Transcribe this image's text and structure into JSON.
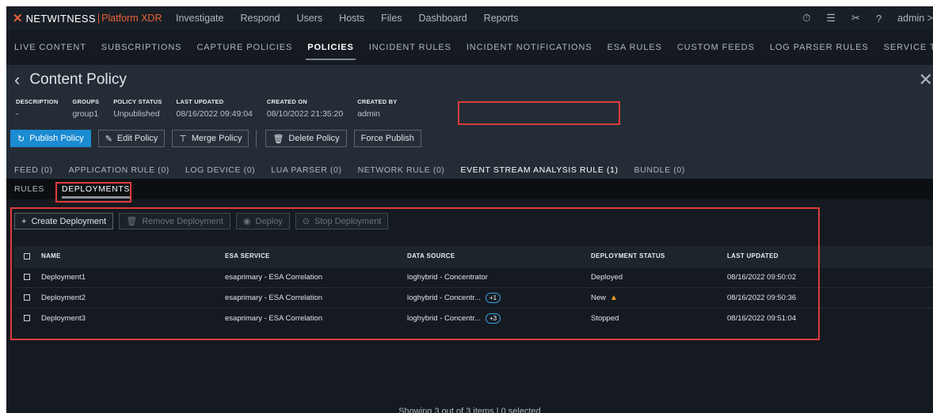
{
  "topnav": {
    "logo": "NETWITNESS",
    "platform": "Platform XDR",
    "items": [
      "Investigate",
      "Respond",
      "Users",
      "Hosts",
      "Files",
      "Dashboard",
      "Reports"
    ],
    "user": "admin >"
  },
  "subnav": {
    "tabs": [
      "LIVE CONTENT",
      "SUBSCRIPTIONS",
      "CAPTURE POLICIES",
      "POLICIES",
      "INCIDENT RULES",
      "INCIDENT NOTIFICATIONS",
      "ESA RULES",
      "CUSTOM FEEDS",
      "LOG PARSER RULES",
      "SERVICE TOPOLOGY"
    ],
    "active": "POLICIES"
  },
  "policy": {
    "title": "Content Policy",
    "meta": [
      {
        "label": "DESCRIPTION",
        "value": "-"
      },
      {
        "label": "GROUPS",
        "value": "group1"
      },
      {
        "label": "POLICY STATUS",
        "value": "Unpublished"
      },
      {
        "label": "LAST UPDATED",
        "value": "08/16/2022 09:49:04"
      },
      {
        "label": "CREATED ON",
        "value": "08/10/2022 21:35:20"
      },
      {
        "label": "CREATED BY",
        "value": "admin"
      }
    ],
    "buttons": {
      "publish": "Publish Policy",
      "edit": "Edit Policy",
      "merge": "Merge Policy",
      "delete": "Delete Policy",
      "force": "Force Publish"
    },
    "rule_tabs": [
      "FEED (0)",
      "APPLICATION RULE (0)",
      "LOG DEVICE (0)",
      "LUA PARSER (0)",
      "NETWORK RULE (0)",
      "EVENT STREAM ANALYSIS RULE (1)",
      "BUNDLE (0)"
    ]
  },
  "tabs2": [
    "RULES",
    "DEPLOYMENTS"
  ],
  "deployments": {
    "toolbar": {
      "create": "Create Deployment",
      "remove": "Remove Deployment",
      "deploy": "Deploy",
      "stop": "Stop Deployment"
    },
    "columns": [
      "NAME",
      "ESA SERVICE",
      "DATA SOURCE",
      "DEPLOYMENT STATUS",
      "LAST UPDATED"
    ],
    "rows": [
      {
        "name": "Deployment1",
        "esa": "esaprimary - ESA Correlation",
        "source": "loghybrid - Concentrator",
        "badge": "",
        "status": "Deployed",
        "warn": false,
        "updated": "08/16/2022 09:50:02"
      },
      {
        "name": "Deployment2",
        "esa": "esaprimary - ESA Correlation",
        "source": "loghybrid - Concentr...",
        "badge": "+1",
        "status": "New",
        "warn": true,
        "updated": "08/16/2022 09:50:36"
      },
      {
        "name": "Deployment3",
        "esa": "esaprimary - ESA Correlation",
        "source": "loghybrid - Concentr...",
        "badge": "+3",
        "status": "Stopped",
        "warn": false,
        "updated": "08/16/2022 09:51:04"
      }
    ],
    "footer": "Showing 3 out of 3 items | 0 selected"
  }
}
